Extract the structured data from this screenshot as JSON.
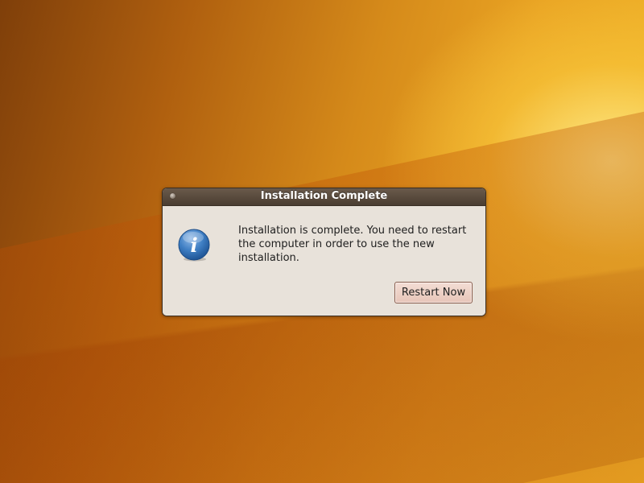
{
  "desktop": {
    "wallpaper_colors": [
      "#7f3f0a",
      "#d58a1a",
      "#f0b528"
    ]
  },
  "dialog": {
    "title": "Installation Complete",
    "message": "Installation is complete. You need to restart the computer in order to use the new installation.",
    "icon": "info-icon",
    "buttons": {
      "restart_label": "Restart Now"
    },
    "colors": {
      "titlebar": "#4a3d31",
      "body": "#e8e2da",
      "button": "#e7c5b8",
      "icon": "#2f6fb0"
    }
  }
}
